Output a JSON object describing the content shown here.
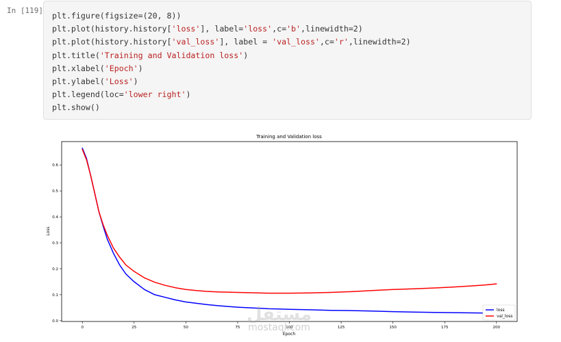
{
  "cell": {
    "prompt": "In [119]:",
    "code_lines": [
      [
        {
          "t": "plt.figure(figsize=(20, 8))"
        }
      ],
      [
        {
          "t": "plt.plot(history.history["
        },
        {
          "t": "'loss'",
          "s": true
        },
        {
          "t": "], label="
        },
        {
          "t": "'loss'",
          "s": true
        },
        {
          "t": ",c="
        },
        {
          "t": "'b'",
          "s": true
        },
        {
          "t": ",linewidth=2)"
        }
      ],
      [
        {
          "t": "plt.plot(history.history["
        },
        {
          "t": "'val_loss'",
          "s": true
        },
        {
          "t": "], label = "
        },
        {
          "t": "'val_loss'",
          "s": true
        },
        {
          "t": ",c="
        },
        {
          "t": "'r'",
          "s": true
        },
        {
          "t": ",linewidth=2)"
        }
      ],
      [
        {
          "t": "plt.title("
        },
        {
          "t": "'Training and Validation loss'",
          "s": true
        },
        {
          "t": ")"
        }
      ],
      [
        {
          "t": "plt.xlabel("
        },
        {
          "t": "'Epoch'",
          "s": true
        },
        {
          "t": ")"
        }
      ],
      [
        {
          "t": "plt.ylabel("
        },
        {
          "t": "'Loss'",
          "s": true
        },
        {
          "t": ")"
        }
      ],
      [
        {
          "t": "plt.legend(loc="
        },
        {
          "t": "'lower right'",
          "s": true
        },
        {
          "t": ")"
        }
      ],
      [
        {
          "t": "plt.show()"
        }
      ]
    ]
  },
  "chart_data": {
    "type": "line",
    "title": "Training and Validation loss",
    "xlabel": "Epoch",
    "ylabel": "Loss",
    "xlim": [
      -10,
      210
    ],
    "ylim": [
      -0.003,
      0.69
    ],
    "xticks": [
      0,
      25,
      50,
      75,
      100,
      125,
      150,
      175,
      200
    ],
    "yticks": [
      0.0,
      0.1,
      0.2,
      0.3,
      0.4,
      0.5,
      0.6
    ],
    "ytick_labels": [
      "0.0",
      "0.1",
      "0.2",
      "0.3",
      "0.4",
      "0.5",
      "0.6"
    ],
    "legend_position": "lower right",
    "grid": false,
    "series": [
      {
        "name": "loss",
        "color": "#0000ff",
        "x": [
          0,
          2,
          4,
          6,
          8,
          10,
          12,
          15,
          18,
          21,
          25,
          30,
          35,
          40,
          45,
          50,
          55,
          60,
          65,
          70,
          75,
          80,
          85,
          90,
          95,
          100,
          110,
          120,
          130,
          140,
          150,
          160,
          170,
          180,
          190,
          200
        ],
        "y": [
          0.665,
          0.625,
          0.56,
          0.49,
          0.42,
          0.365,
          0.315,
          0.26,
          0.215,
          0.18,
          0.15,
          0.12,
          0.1,
          0.09,
          0.08,
          0.072,
          0.067,
          0.062,
          0.058,
          0.055,
          0.052,
          0.05,
          0.048,
          0.046,
          0.045,
          0.044,
          0.042,
          0.04,
          0.039,
          0.037,
          0.035,
          0.033,
          0.032,
          0.031,
          0.03,
          0.029
        ]
      },
      {
        "name": "val_loss",
        "color": "#ff0000",
        "x": [
          0,
          2,
          4,
          6,
          8,
          10,
          12,
          15,
          18,
          21,
          25,
          30,
          35,
          40,
          45,
          50,
          55,
          60,
          65,
          70,
          75,
          80,
          85,
          90,
          95,
          100,
          110,
          120,
          130,
          140,
          150,
          160,
          170,
          180,
          190,
          195,
          200
        ],
        "y": [
          0.66,
          0.62,
          0.56,
          0.49,
          0.42,
          0.37,
          0.33,
          0.28,
          0.245,
          0.215,
          0.19,
          0.165,
          0.148,
          0.136,
          0.127,
          0.12,
          0.116,
          0.113,
          0.111,
          0.11,
          0.109,
          0.108,
          0.107,
          0.106,
          0.106,
          0.106,
          0.107,
          0.109,
          0.112,
          0.116,
          0.12,
          0.123,
          0.126,
          0.13,
          0.135,
          0.138,
          0.142
        ]
      }
    ]
  },
  "watermark": {
    "logo_text": "مستقل",
    "site": "mostaql.com"
  }
}
